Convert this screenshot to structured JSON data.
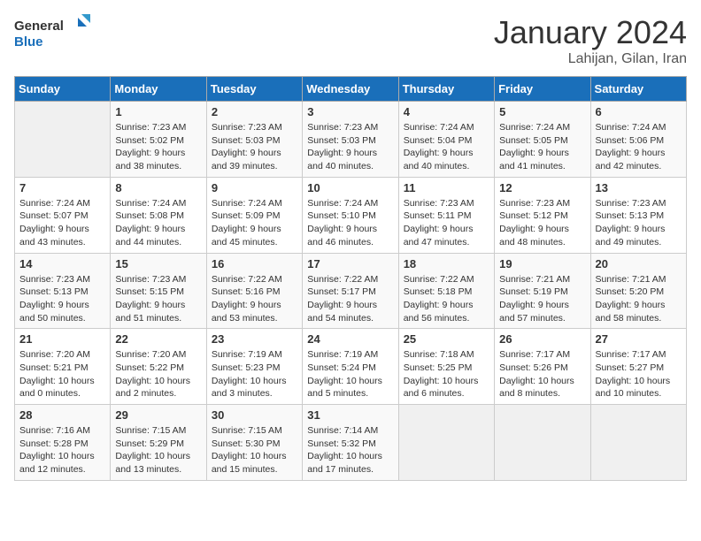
{
  "header": {
    "logo_line1": "General",
    "logo_line2": "Blue",
    "month": "January 2024",
    "location": "Lahijan, Gilan, Iran"
  },
  "days_of_week": [
    "Sunday",
    "Monday",
    "Tuesday",
    "Wednesday",
    "Thursday",
    "Friday",
    "Saturday"
  ],
  "weeks": [
    [
      {
        "day": "",
        "sunrise": "",
        "sunset": "",
        "daylight": ""
      },
      {
        "day": "1",
        "sunrise": "Sunrise: 7:23 AM",
        "sunset": "Sunset: 5:02 PM",
        "daylight": "Daylight: 9 hours and 38 minutes."
      },
      {
        "day": "2",
        "sunrise": "Sunrise: 7:23 AM",
        "sunset": "Sunset: 5:03 PM",
        "daylight": "Daylight: 9 hours and 39 minutes."
      },
      {
        "day": "3",
        "sunrise": "Sunrise: 7:23 AM",
        "sunset": "Sunset: 5:03 PM",
        "daylight": "Daylight: 9 hours and 40 minutes."
      },
      {
        "day": "4",
        "sunrise": "Sunrise: 7:24 AM",
        "sunset": "Sunset: 5:04 PM",
        "daylight": "Daylight: 9 hours and 40 minutes."
      },
      {
        "day": "5",
        "sunrise": "Sunrise: 7:24 AM",
        "sunset": "Sunset: 5:05 PM",
        "daylight": "Daylight: 9 hours and 41 minutes."
      },
      {
        "day": "6",
        "sunrise": "Sunrise: 7:24 AM",
        "sunset": "Sunset: 5:06 PM",
        "daylight": "Daylight: 9 hours and 42 minutes."
      }
    ],
    [
      {
        "day": "7",
        "sunrise": "Sunrise: 7:24 AM",
        "sunset": "Sunset: 5:07 PM",
        "daylight": "Daylight: 9 hours and 43 minutes."
      },
      {
        "day": "8",
        "sunrise": "Sunrise: 7:24 AM",
        "sunset": "Sunset: 5:08 PM",
        "daylight": "Daylight: 9 hours and 44 minutes."
      },
      {
        "day": "9",
        "sunrise": "Sunrise: 7:24 AM",
        "sunset": "Sunset: 5:09 PM",
        "daylight": "Daylight: 9 hours and 45 minutes."
      },
      {
        "day": "10",
        "sunrise": "Sunrise: 7:24 AM",
        "sunset": "Sunset: 5:10 PM",
        "daylight": "Daylight: 9 hours and 46 minutes."
      },
      {
        "day": "11",
        "sunrise": "Sunrise: 7:23 AM",
        "sunset": "Sunset: 5:11 PM",
        "daylight": "Daylight: 9 hours and 47 minutes."
      },
      {
        "day": "12",
        "sunrise": "Sunrise: 7:23 AM",
        "sunset": "Sunset: 5:12 PM",
        "daylight": "Daylight: 9 hours and 48 minutes."
      },
      {
        "day": "13",
        "sunrise": "Sunrise: 7:23 AM",
        "sunset": "Sunset: 5:13 PM",
        "daylight": "Daylight: 9 hours and 49 minutes."
      }
    ],
    [
      {
        "day": "14",
        "sunrise": "Sunrise: 7:23 AM",
        "sunset": "Sunset: 5:13 PM",
        "daylight": "Daylight: 9 hours and 50 minutes."
      },
      {
        "day": "15",
        "sunrise": "Sunrise: 7:23 AM",
        "sunset": "Sunset: 5:15 PM",
        "daylight": "Daylight: 9 hours and 51 minutes."
      },
      {
        "day": "16",
        "sunrise": "Sunrise: 7:22 AM",
        "sunset": "Sunset: 5:16 PM",
        "daylight": "Daylight: 9 hours and 53 minutes."
      },
      {
        "day": "17",
        "sunrise": "Sunrise: 7:22 AM",
        "sunset": "Sunset: 5:17 PM",
        "daylight": "Daylight: 9 hours and 54 minutes."
      },
      {
        "day": "18",
        "sunrise": "Sunrise: 7:22 AM",
        "sunset": "Sunset: 5:18 PM",
        "daylight": "Daylight: 9 hours and 56 minutes."
      },
      {
        "day": "19",
        "sunrise": "Sunrise: 7:21 AM",
        "sunset": "Sunset: 5:19 PM",
        "daylight": "Daylight: 9 hours and 57 minutes."
      },
      {
        "day": "20",
        "sunrise": "Sunrise: 7:21 AM",
        "sunset": "Sunset: 5:20 PM",
        "daylight": "Daylight: 9 hours and 58 minutes."
      }
    ],
    [
      {
        "day": "21",
        "sunrise": "Sunrise: 7:20 AM",
        "sunset": "Sunset: 5:21 PM",
        "daylight": "Daylight: 10 hours and 0 minutes."
      },
      {
        "day": "22",
        "sunrise": "Sunrise: 7:20 AM",
        "sunset": "Sunset: 5:22 PM",
        "daylight": "Daylight: 10 hours and 2 minutes."
      },
      {
        "day": "23",
        "sunrise": "Sunrise: 7:19 AM",
        "sunset": "Sunset: 5:23 PM",
        "daylight": "Daylight: 10 hours and 3 minutes."
      },
      {
        "day": "24",
        "sunrise": "Sunrise: 7:19 AM",
        "sunset": "Sunset: 5:24 PM",
        "daylight": "Daylight: 10 hours and 5 minutes."
      },
      {
        "day": "25",
        "sunrise": "Sunrise: 7:18 AM",
        "sunset": "Sunset: 5:25 PM",
        "daylight": "Daylight: 10 hours and 6 minutes."
      },
      {
        "day": "26",
        "sunrise": "Sunrise: 7:17 AM",
        "sunset": "Sunset: 5:26 PM",
        "daylight": "Daylight: 10 hours and 8 minutes."
      },
      {
        "day": "27",
        "sunrise": "Sunrise: 7:17 AM",
        "sunset": "Sunset: 5:27 PM",
        "daylight": "Daylight: 10 hours and 10 minutes."
      }
    ],
    [
      {
        "day": "28",
        "sunrise": "Sunrise: 7:16 AM",
        "sunset": "Sunset: 5:28 PM",
        "daylight": "Daylight: 10 hours and 12 minutes."
      },
      {
        "day": "29",
        "sunrise": "Sunrise: 7:15 AM",
        "sunset": "Sunset: 5:29 PM",
        "daylight": "Daylight: 10 hours and 13 minutes."
      },
      {
        "day": "30",
        "sunrise": "Sunrise: 7:15 AM",
        "sunset": "Sunset: 5:30 PM",
        "daylight": "Daylight: 10 hours and 15 minutes."
      },
      {
        "day": "31",
        "sunrise": "Sunrise: 7:14 AM",
        "sunset": "Sunset: 5:32 PM",
        "daylight": "Daylight: 10 hours and 17 minutes."
      },
      {
        "day": "",
        "sunrise": "",
        "sunset": "",
        "daylight": ""
      },
      {
        "day": "",
        "sunrise": "",
        "sunset": "",
        "daylight": ""
      },
      {
        "day": "",
        "sunrise": "",
        "sunset": "",
        "daylight": ""
      }
    ]
  ]
}
